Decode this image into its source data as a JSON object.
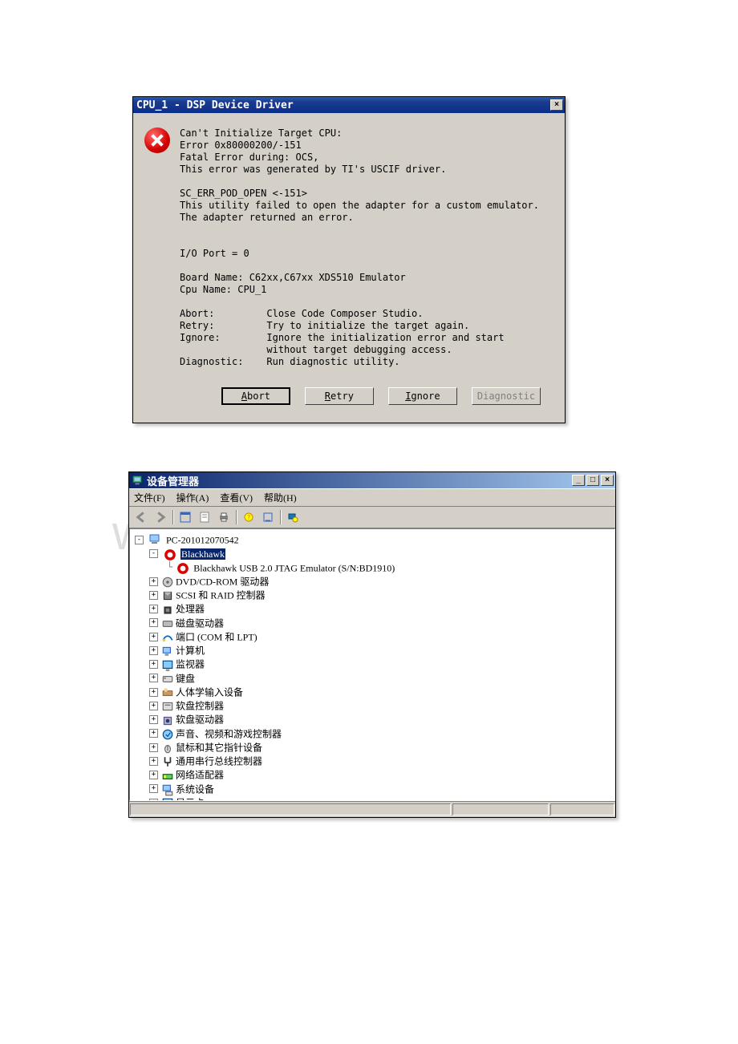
{
  "watermark": "www.bdocx.com",
  "dialog1": {
    "title": "CPU_1 - DSP Device Driver",
    "message": "Can't Initialize Target CPU:\nError 0x80000200/-151\nFatal Error during: OCS,\nThis error was generated by TI's USCIF driver.\n\nSC_ERR_POD_OPEN <-151>\nThis utility failed to open the adapter for a custom emulator.\nThe adapter returned an error.\n\n\nI/O Port = 0\n\nBoard Name: C62xx,C67xx XDS510 Emulator\nCpu Name: CPU_1\n\nAbort:         Close Code Composer Studio.\nRetry:         Try to initialize the target again.\nIgnore:        Ignore the initialization error and start\n               without target debugging access.\nDiagnostic:    Run diagnostic utility.",
    "buttons": {
      "abort": "Abort",
      "retry": "Retry",
      "ignore": "Ignore",
      "diagnostic": "Diagnostic"
    }
  },
  "dialog2": {
    "title": "设备管理器",
    "menu": {
      "file": "文件(F)",
      "action": "操作(A)",
      "view": "查看(V)",
      "help": "帮助(H)"
    },
    "tree": {
      "root": "PC-201012070542",
      "blackhawk": "Blackhawk",
      "blackhawk_child": "Blackhawk USB 2.0 JTAG Emulator (S/N:BD1910)",
      "items": [
        "DVD/CD-ROM 驱动器",
        "SCSI 和 RAID 控制器",
        "处理器",
        "磁盘驱动器",
        "端口 (COM 和 LPT)",
        "计算机",
        "监视器",
        "键盘",
        "人体学输入设备",
        "软盘控制器",
        "软盘驱动器",
        "声音、视频和游戏控制器",
        "鼠标和其它指针设备",
        "通用串行总线控制器",
        "网络适配器",
        "系统设备",
        "显示卡"
      ]
    }
  }
}
